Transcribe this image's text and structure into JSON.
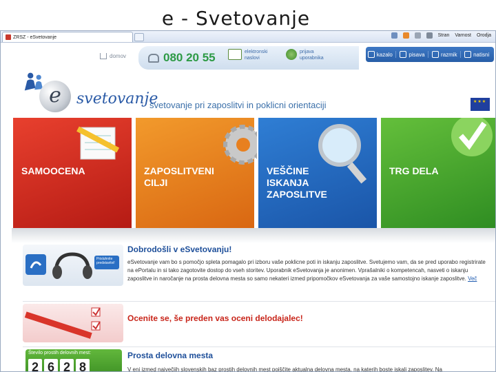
{
  "slide": {
    "title": "e - Svetovanje"
  },
  "browser": {
    "tab_title": "ZRSZ - eSvetovanje",
    "tools": {
      "page": "Stran",
      "safety": "Varnost",
      "tools": "Orodja"
    }
  },
  "header": {
    "home_label": "domov",
    "phone": "080 20 55",
    "email_label_1": "elektronski",
    "email_label_2": "naslovi",
    "login_label_1": "prijava",
    "login_label_2": "uporabnika",
    "right_buttons": [
      "kazalo",
      "pisava",
      "razmik",
      "natisni"
    ]
  },
  "logo": {
    "word": "svetovanje",
    "letter": "e"
  },
  "tagline": "svetovanje pri zaposlitvi in poklicni orientaciji",
  "tiles": [
    {
      "lines": [
        "SAMOOCENA"
      ],
      "color": "#d42e22"
    },
    {
      "lines": [
        "ZAPOSLITVENI",
        "CILJI"
      ],
      "color": "#e8801f"
    },
    {
      "lines": [
        "VEŠČINE",
        "ISKANJA",
        "ZAPOSLITVE"
      ],
      "color": "#2a6fc4"
    },
    {
      "lines": [
        "TRG DELA"
      ],
      "color": "#4fae30"
    }
  ],
  "welcome": {
    "title": "Dobrodošli v eSvetovanju!",
    "listen_label": "Prisluhnite predstavitvi!",
    "text": "eSvetovanje vam bo s pomočjo spleta pomagalo pri izboru vaše poklicne poti in iskanju zaposlitve. Svetujemo vam, da se pred uporabo registrirate na ePortalu in si tako zagotovite dostop do vseh storitev. Uporabnik eSvetovanja je anonimen. Vprašalniki o kompetencah, nasveti o iskanju zaposlitve in naročanje na prosta delovna mesta so samo nekateri izmed pripomočkov eSvetovanja za vaše samostojno iskanje zaposlitve.",
    "more": "Več"
  },
  "assess": {
    "title": "Ocenite se, še preden vas oceni delodajalec!"
  },
  "jobs": {
    "title": "Prosta delovna mesta",
    "counter_label": "Število prostih delovnih mest:",
    "digits": [
      "2",
      "6",
      "2",
      "8"
    ],
    "text": "V eni izmed največjih slovenskih baz prostih delovnih mest poiščite aktualna delovna mesta, na katerih boste iskali zaposlitev. Na"
  }
}
